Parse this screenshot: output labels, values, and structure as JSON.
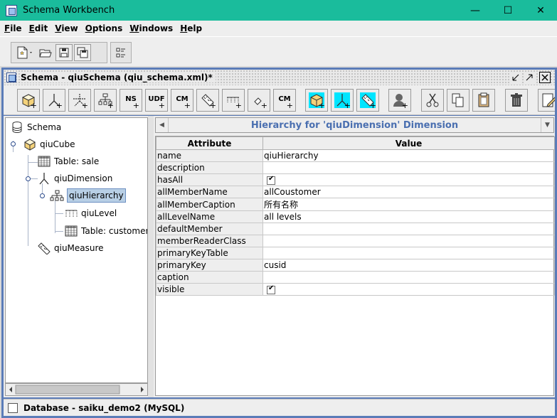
{
  "window": {
    "title": "Schema Workbench",
    "controls": [
      "—",
      "☐",
      "✕"
    ]
  },
  "menubar": [
    {
      "underline": "F",
      "rest": "ile"
    },
    {
      "underline": "E",
      "rest": "dit"
    },
    {
      "underline": "V",
      "rest": "iew"
    },
    {
      "underline": "O",
      "rest": "ptions"
    },
    {
      "underline": "W",
      "rest": "indows"
    },
    {
      "underline": "H",
      "rest": "elp"
    }
  ],
  "frame": {
    "title": "Schema - qiuSchema (qiu_schema.xml)*"
  },
  "frame_toolbar": {
    "text_buttons": {
      "ns": "NS",
      "udf": "UDF",
      "cm": "CM",
      "cm2": "CM"
    }
  },
  "tree": {
    "root": "Schema",
    "cube": "qiuCube",
    "cube_table": "Table: sale",
    "dimension": "qiuDimension",
    "hierarchy": "qiuHierarchy",
    "level": "qiuLevel",
    "hierarchy_table": "Table: customer",
    "measure": "qiuMeasure"
  },
  "panel": {
    "header": "Hierarchy for 'qiuDimension' Dimension",
    "columns": [
      "Attribute",
      "Value"
    ],
    "rows": [
      {
        "attr": "name",
        "value": "qiuHierarchy",
        "checkbox": false
      },
      {
        "attr": "description",
        "value": "",
        "checkbox": false
      },
      {
        "attr": "hasAll",
        "value": "",
        "checkbox": true
      },
      {
        "attr": "allMemberName",
        "value": "allCoustomer",
        "checkbox": false
      },
      {
        "attr": "allMemberCaption",
        "value": "所有名称",
        "checkbox": false
      },
      {
        "attr": "allLevelName",
        "value": "all levels",
        "checkbox": false
      },
      {
        "attr": "defaultMember",
        "value": "",
        "checkbox": false
      },
      {
        "attr": "memberReaderClass",
        "value": "",
        "checkbox": false
      },
      {
        "attr": "primaryKeyTable",
        "value": "",
        "checkbox": false
      },
      {
        "attr": "primaryKey",
        "value": "cusid",
        "checkbox": false
      },
      {
        "attr": "caption",
        "value": "",
        "checkbox": false
      },
      {
        "attr": "visible",
        "value": "",
        "checkbox": true
      }
    ]
  },
  "status": {
    "text": "Database - saiku_demo2 (MySQL)"
  },
  "colors": {
    "titlebar": "#1abc9c",
    "frame_border": "#5b7cb8",
    "header_text": "#4a6fb0",
    "selection": "#b8cfe5"
  }
}
